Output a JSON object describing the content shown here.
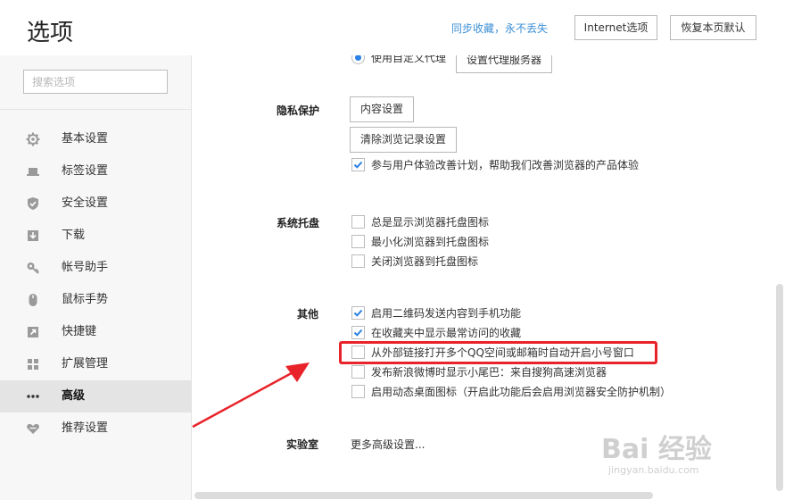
{
  "header": {
    "title": "选项",
    "sync_link": "同步收藏，永不丢失",
    "internet_options_label": "Internet选项",
    "restore_default_label": "恢复本页默认"
  },
  "sidebar": {
    "search_placeholder": "搜索选项",
    "items": [
      {
        "label": "基本设置",
        "icon": "gear-icon"
      },
      {
        "label": "标签设置",
        "icon": "tab-icon"
      },
      {
        "label": "安全设置",
        "icon": "shield-icon"
      },
      {
        "label": "下载",
        "icon": "download-icon"
      },
      {
        "label": "帐号助手",
        "icon": "key-icon"
      },
      {
        "label": "鼠标手势",
        "icon": "mouse-icon"
      },
      {
        "label": "快捷键",
        "icon": "shortcut-arrow-icon"
      },
      {
        "label": "扩展管理",
        "icon": "grid-icon"
      },
      {
        "label": "高级",
        "icon": "ellipsis-icon",
        "active": true
      },
      {
        "label": "推荐设置",
        "icon": "heart-icon"
      }
    ]
  },
  "proxy": {
    "option_label": "使用自定义代理",
    "button_label": "设置代理服务器"
  },
  "privacy": {
    "label": "隐私保护",
    "content_settings_label": "内容设置",
    "clear_history_label": "清除浏览记录设置",
    "experience_plan_label": "参与用户体验改善计划，帮助我们改善浏览器的产品体验"
  },
  "tray": {
    "label": "系统托盘",
    "options": [
      {
        "label": "总是显示浏览器托盘图标",
        "checked": false
      },
      {
        "label": "最小化浏览器到托盘图标",
        "checked": false
      },
      {
        "label": "关闭浏览器到托盘图标",
        "checked": false
      }
    ]
  },
  "other": {
    "label": "其他",
    "options": [
      {
        "label": "启用二维码发送内容到手机功能",
        "checked": true
      },
      {
        "label": "在收藏夹中显示最常访问的收藏",
        "checked": true
      },
      {
        "label": "从外部链接打开多个QQ空间或邮箱时自动开启小号窗口",
        "checked": false
      },
      {
        "label": "发布新浪微博时显示小尾巴：来自搜狗高速浏览器",
        "checked": false
      },
      {
        "label": "启用动态桌面图标（开启此功能后会启用浏览器安全防护机制）",
        "checked": false
      }
    ]
  },
  "lab": {
    "label": "实验室",
    "more_label": "更多高级设置..."
  },
  "watermark": {
    "logo": "Bai 经验",
    "sub": "jingyan.baidu.com"
  },
  "colors": {
    "accent": "#2a82e4",
    "link": "#3c8fd6",
    "annotation": "#e8232a",
    "sidebar_bg": "#f7f7f7",
    "active_item_bg": "#e4e4e4"
  }
}
